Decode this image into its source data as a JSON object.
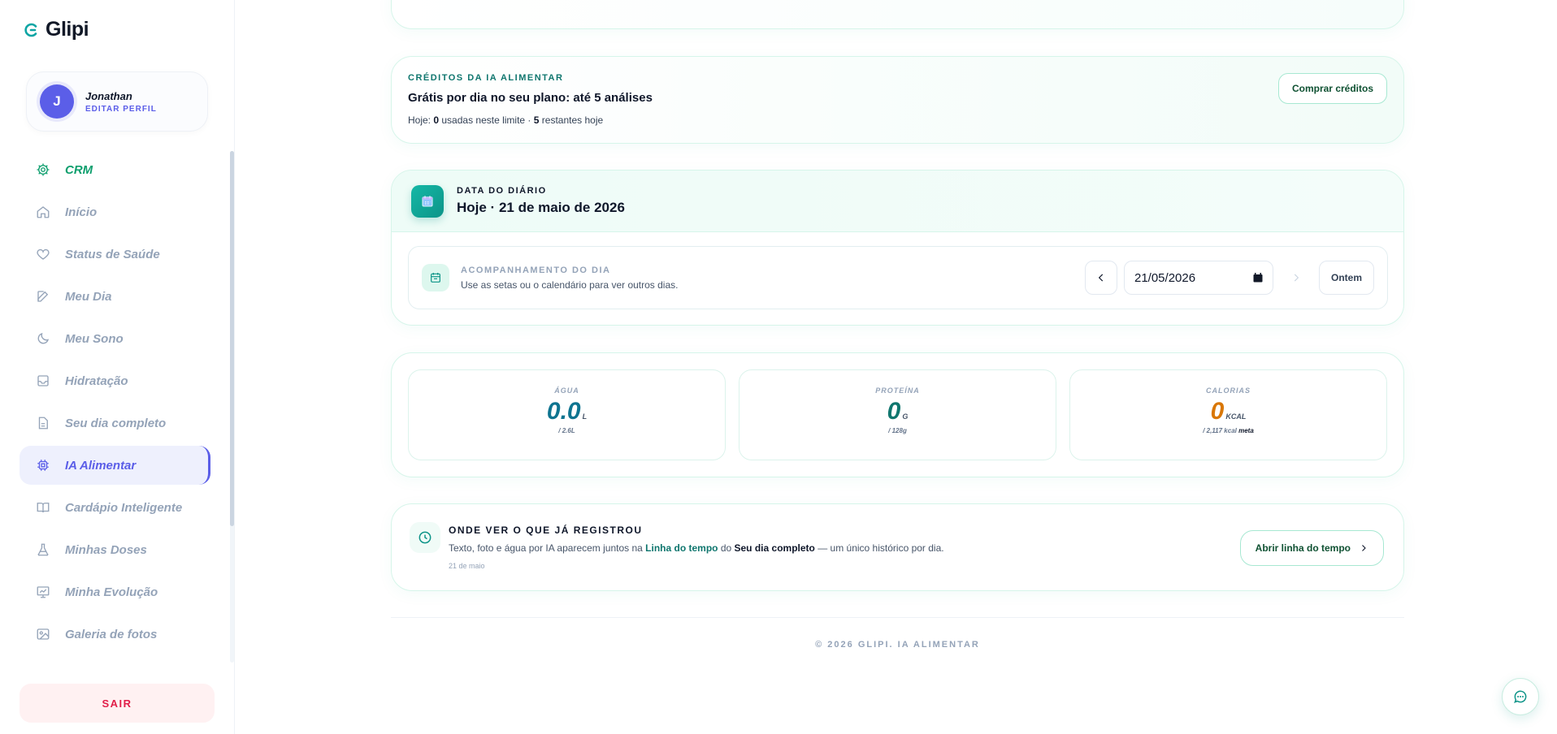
{
  "app": {
    "name": "Glipi"
  },
  "profile": {
    "initial": "J",
    "name": "Jonathan",
    "edit_label": "EDITAR PERFIL"
  },
  "sidebar": {
    "items": [
      {
        "label": "CRM",
        "icon": "gear-icon"
      },
      {
        "label": "Início",
        "icon": "home-icon"
      },
      {
        "label": "Status de Saúde",
        "icon": "heart-icon"
      },
      {
        "label": "Meu Dia",
        "icon": "edit-icon"
      },
      {
        "label": "Meu Sono",
        "icon": "moon-icon"
      },
      {
        "label": "Hidratação",
        "icon": "inbox-icon"
      },
      {
        "label": "Seu dia completo",
        "icon": "file-icon"
      },
      {
        "label": "IA Alimentar",
        "icon": "chip-icon"
      },
      {
        "label": "Cardápio Inteligente",
        "icon": "book-icon"
      },
      {
        "label": "Minhas Doses",
        "icon": "flask-icon"
      },
      {
        "label": "Minha Evolução",
        "icon": "chart-icon"
      },
      {
        "label": "Galeria de fotos",
        "icon": "image-icon"
      }
    ],
    "active": "IA Alimentar",
    "logout_label": "SAIR"
  },
  "credits": {
    "overline": "CRÉDITOS DA IA ALIMENTAR",
    "title": "Grátis por dia no seu plano: até 5 análises",
    "today_prefix": "Hoje: ",
    "used": "0",
    "used_suffix": " usadas neste limite · ",
    "remaining": "5",
    "remaining_suffix": " restantes hoje",
    "buy_label": "Comprar créditos"
  },
  "diary": {
    "overline": "DATA DO DIÁRIO",
    "title": "Hoje · 21 de maio de 2026",
    "track_overline": "ACOMPANHAMENTO DO DIA",
    "track_sub": "Use as setas ou o calendário para ver outros dias.",
    "date_value": "21/05/2026",
    "yesterday_label": "Ontem"
  },
  "metrics": [
    {
      "label": "ÁGUA",
      "value": "0.0",
      "unit": "L",
      "goal": "/ 2.6L",
      "color": "#0e7490"
    },
    {
      "label": "PROTEÍNA",
      "value": "0",
      "unit": "G",
      "goal": "/ 128g",
      "color": "#0f766e"
    },
    {
      "label": "CALORIAS",
      "value": "0",
      "unit": "KCAL",
      "goal": "/ 2,117 kcal",
      "goal_tag": "meta",
      "color": "#d97706"
    }
  ],
  "history": {
    "title": "ONDE VER O QUE JÁ REGISTROU",
    "desc_a": "Texto, foto e água por IA aparecem juntos na ",
    "link_a": "Linha do tempo",
    "desc_b": " do ",
    "link_b": "Seu dia completo",
    "desc_c": " — um único histórico por dia.",
    "date": "21 de maio",
    "button_label": "Abrir linha do tempo"
  },
  "footer": {
    "text": "© 2026 GLIPI. IA ALIMENTAR"
  }
}
